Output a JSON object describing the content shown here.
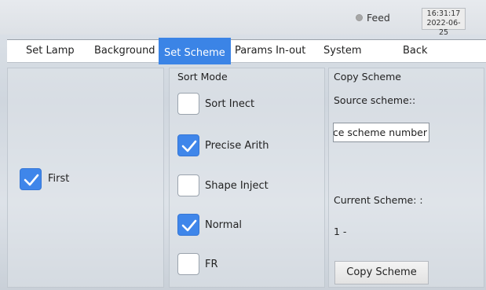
{
  "status": {
    "feed_label": "Feed",
    "feed_color": "#a7a7a7",
    "time": "16:31:17",
    "date": "2022-06-25"
  },
  "tabs": [
    {
      "label": "Set Lamp"
    },
    {
      "label": "Background"
    },
    {
      "label": "Set Scheme",
      "active": true
    },
    {
      "label": "Params In-out"
    },
    {
      "label": "System"
    },
    {
      "label": "Back"
    }
  ],
  "left_panel": {
    "first": {
      "label": "First",
      "checked": true
    }
  },
  "sort_mode": {
    "title": "Sort Mode",
    "options": [
      {
        "label": "Sort Inect",
        "checked": false
      },
      {
        "label": "Precise Arith",
        "checked": true
      },
      {
        "label": "Shape Inject",
        "checked": false
      },
      {
        "label": "Normal",
        "checked": true
      },
      {
        "label": "FR",
        "checked": false
      }
    ]
  },
  "copy_scheme": {
    "title": "Copy Scheme",
    "source_label": "Source scheme::",
    "source_placeholder": "Source scheme number",
    "current_label": "Current Scheme: :",
    "current_value": "1 -",
    "button_label": "Copy Scheme"
  },
  "colors": {
    "accent": "#3b84e6",
    "checkbox_checked": "#3f86ea"
  }
}
